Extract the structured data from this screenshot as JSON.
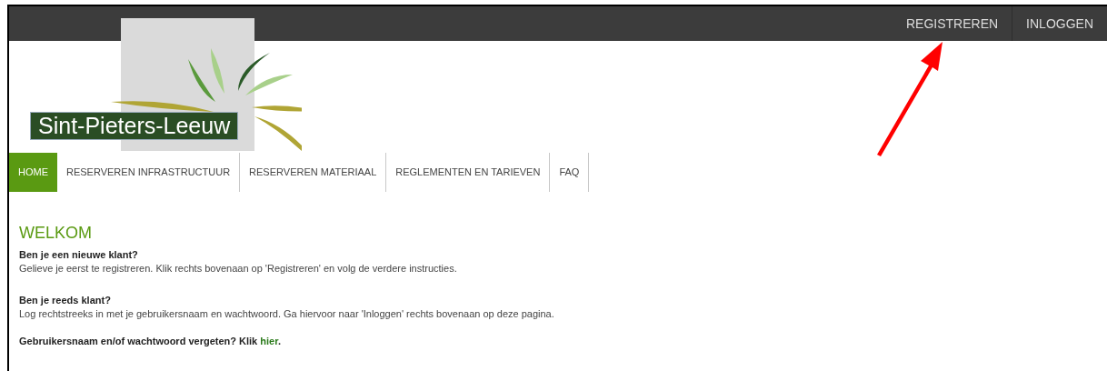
{
  "top_bar": {
    "links": [
      "REGISTREREN",
      "INLOGGEN"
    ]
  },
  "logo": {
    "text": "Sint-Pieters-Leeuw"
  },
  "nav": [
    {
      "label": "HOME",
      "selected": true
    },
    {
      "label": "RESERVEREN INFRASTRUCTUUR",
      "selected": false
    },
    {
      "label": "RESERVEREN MATERIAAL",
      "selected": false
    },
    {
      "label": "REGLEMENTEN EN TARIEVEN",
      "selected": false
    },
    {
      "label": "FAQ",
      "selected": false
    }
  ],
  "content": {
    "heading": "WELKOM",
    "sections": [
      {
        "question": "Ben je een nieuwe klant?",
        "text": "Gelieve je eerst te registreren. Klik rechts bovenaan op 'Registreren' en volg de verdere instructies."
      },
      {
        "question": "Ben je reeds klant?",
        "text": "Log rechtstreeks in met je gebruikersnaam en wachtwoord. Ga hiervoor naar 'Inloggen' rechts bovenaan op deze pagina."
      }
    ],
    "forgot": {
      "text": "Gebruikersnaam en/of wachtwoord vergeten? Klik",
      "link": "hier",
      "tail": "."
    }
  }
}
